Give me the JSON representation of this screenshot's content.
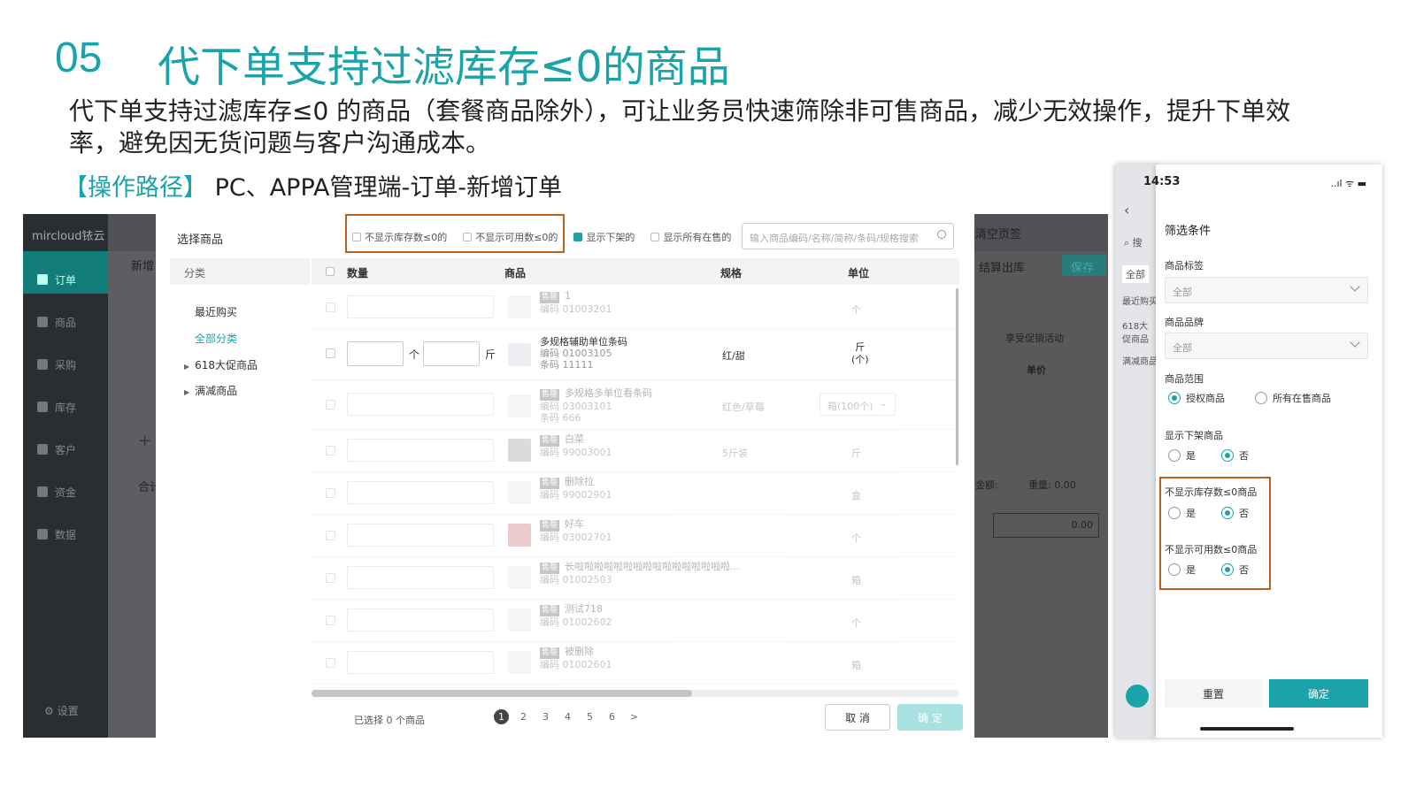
{
  "slide": {
    "number": "05",
    "title": "代下单支持过滤库存≤0的商品",
    "description": "代下单支持过滤库存≤0 的商品（套餐商品除外），可让业务员快速筛除非可售商品，减少无效操作，提升下单效率，避免因无货问题与客户沟通成本。",
    "path_label": "【操作路径】",
    "path_value": " PC、APPA管理端-订单-新增订单"
  },
  "pc": {
    "logo": "mircloud铱云",
    "nav": [
      {
        "label": "订单"
      },
      {
        "label": "商品"
      },
      {
        "label": "采购"
      },
      {
        "label": "库存"
      },
      {
        "label": "客户"
      },
      {
        "label": "资金"
      },
      {
        "label": "数据"
      }
    ],
    "settings": "设置",
    "bg_texts": {
      "new_tab": "新增",
      "clear": "清空页签",
      "settle": "结算出库",
      "save": "保存",
      "promo": "享受促销活动",
      "price": "单价",
      "weight": "重量: 0.00",
      "amount": "金额:",
      "total": "0.00",
      "add": "+",
      "sum": "合计"
    },
    "modal": {
      "title": "选择商品",
      "filters": [
        {
          "label": "不显示库存数≤0的",
          "checked": false
        },
        {
          "label": "不显示可用数≤0的",
          "checked": false
        },
        {
          "label": "显示下架的",
          "checked": true
        },
        {
          "label": "显示所有在售的",
          "checked": false
        }
      ],
      "search_placeholder": "输入商品编码/名称/简称/条码/规格搜索",
      "category_header": "分类",
      "categories": [
        "最近购买",
        "全部分类",
        "618大促商品",
        "满减商品"
      ],
      "columns": [
        "数量",
        "商品",
        "规格",
        "单位"
      ],
      "rows": [
        {
          "tag": "售罄",
          "name": "1",
          "code": "编码 01003201",
          "barcode": "",
          "spec": "",
          "unit": "个"
        },
        {
          "tag": "",
          "name": "多规格辅助单位条码",
          "code": "编码 01003105",
          "barcode": "条码 11111",
          "spec": "红/甜",
          "unit": "斤",
          "unit2": "(个)",
          "qty_unit1": "个",
          "qty_unit2": "斤"
        },
        {
          "tag": "售罄",
          "name": "多规格多单位看条码",
          "code": "编码 03003101",
          "barcode": "条码 666",
          "spec": "红色/草莓",
          "unit": "箱(100个)"
        },
        {
          "tag": "售罄",
          "name": "白菜",
          "code": "编码 99003001",
          "barcode": "",
          "spec": "5斤装",
          "unit": "斤"
        },
        {
          "tag": "售罄",
          "name": "删除拉",
          "code": "编码 99002901",
          "barcode": "",
          "spec": "",
          "unit": "盒"
        },
        {
          "tag": "售罄",
          "name": "好车",
          "code": "编码 03002701",
          "barcode": "",
          "spec": "",
          "unit": "个"
        },
        {
          "tag": "售罄",
          "name": "长啦啦啦啦啦啦啦啦啦啦啦啦啦啦啦啦...",
          "code": "编码 01002503",
          "barcode": "",
          "spec": "",
          "unit": "箱"
        },
        {
          "tag": "售罄",
          "name": "测试718",
          "code": "编码 01002602",
          "barcode": "",
          "spec": "",
          "unit": "个"
        },
        {
          "tag": "售罄",
          "name": "被删除",
          "code": "编码 01002601",
          "barcode": "",
          "spec": "",
          "unit": "箱"
        }
      ],
      "selected_text": "已选择 0 个商品",
      "pages": [
        "1",
        "2",
        "3",
        "4",
        "5",
        "6",
        ">"
      ],
      "cancel": "取 消",
      "confirm": "确 定"
    }
  },
  "mobile": {
    "time": "14:53",
    "status": "..ıl ᯤ ▬",
    "bg_texts": [
      "全部",
      "最近购买",
      "618大促商品",
      "满减商品",
      "搜"
    ],
    "filter_title": "筛选条件",
    "tag_label": "商品标签",
    "tag_value": "全部",
    "brand_label": "商品品牌",
    "brand_value": "全部",
    "range_label": "商品范围",
    "range_options": [
      "授权商品",
      "所有在售商品"
    ],
    "offshelf_label": "显示下架商品",
    "stock_label": "不显示库存数≤0商品",
    "avail_label": "不显示可用数≤0商品",
    "yes": "是",
    "no": "否",
    "reset": "重置",
    "confirm": "确定"
  },
  "colors": {
    "accent": "#1aa3a8",
    "highlight_border": "#c0601e"
  }
}
